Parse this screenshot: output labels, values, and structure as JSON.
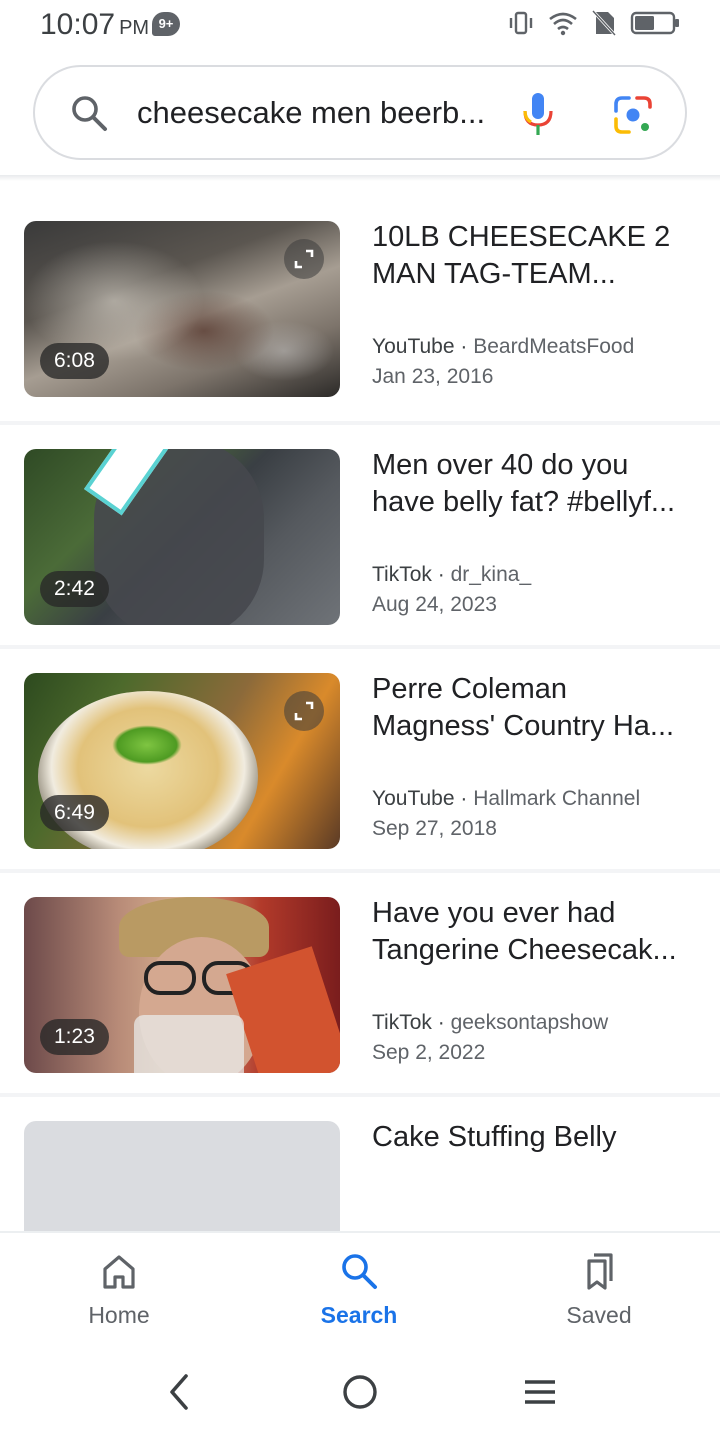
{
  "status_bar": {
    "time": "10:07",
    "ampm": "PM",
    "notification_badge": "9+",
    "icons": [
      "vibrate-icon",
      "wifi-icon",
      "no-sim-icon",
      "battery-icon"
    ]
  },
  "search": {
    "query": "cheesecake men beerb..."
  },
  "results": [
    {
      "title": "10LB CHEESECAKE 2 MAN TAG-TEAM...",
      "source": "YouTube",
      "channel": "BeardMeatsFood",
      "date": "Jan 23, 2016",
      "duration": "6:08",
      "has_expand": true
    },
    {
      "title": "Men over 40 do you have belly fat? #bellyf...",
      "source": "TikTok",
      "channel": "dr_kina_",
      "date": "Aug 24, 2023",
      "duration": "2:42",
      "has_expand": false
    },
    {
      "title": "Perre Coleman Magness' Country Ha...",
      "source": "YouTube",
      "channel": "Hallmark Channel",
      "date": "Sep 27, 2018",
      "duration": "6:49",
      "has_expand": true
    },
    {
      "title": "Have you ever had Tangerine Cheesecak...",
      "source": "TikTok",
      "channel": "geeksontapshow",
      "date": "Sep 2, 2022",
      "duration": "1:23",
      "has_expand": false
    },
    {
      "title": "Cake Stuffing Belly",
      "source": "",
      "channel": "",
      "date": "",
      "duration": "",
      "has_expand": false
    }
  ],
  "bottom_nav": {
    "items": [
      {
        "label": "Home",
        "icon": "home-icon",
        "active": false
      },
      {
        "label": "Search",
        "icon": "search-icon",
        "active": true
      },
      {
        "label": "Saved",
        "icon": "bookmarks-icon",
        "active": false
      }
    ]
  },
  "system_nav": {
    "icons": [
      "back-icon",
      "home-circle-icon",
      "recents-icon"
    ]
  },
  "colors": {
    "accent": "#1a73e8",
    "text_primary": "#202124",
    "text_secondary": "#5f6368"
  }
}
